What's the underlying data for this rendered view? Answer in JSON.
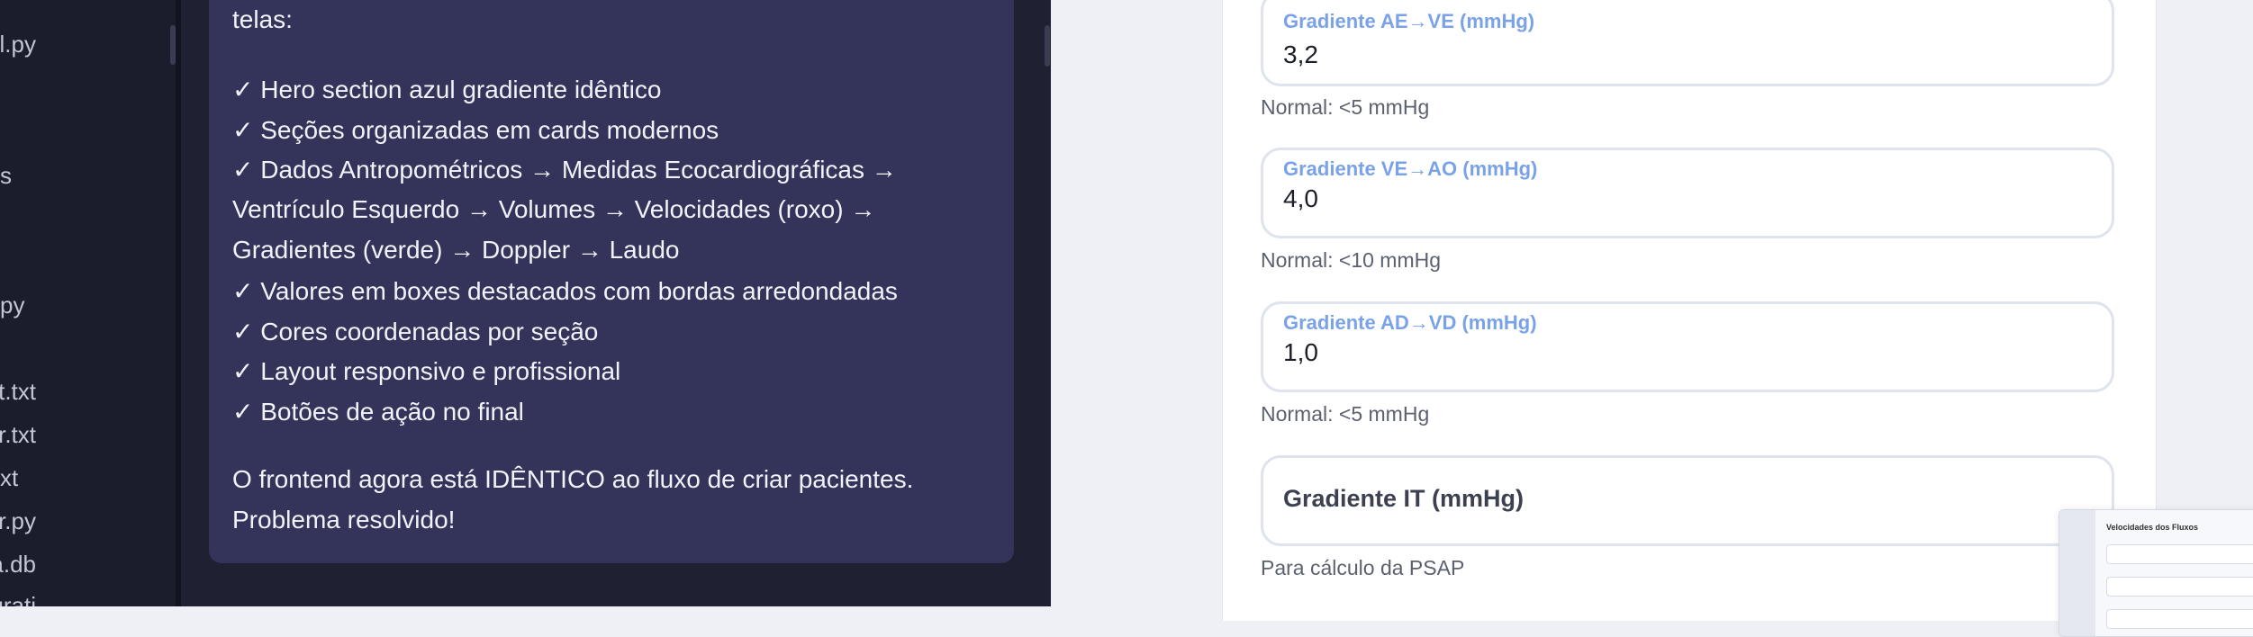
{
  "explorer": {
    "files": [
      "l.py",
      "s",
      "py",
      "est.txt",
      "user.txt",
      "xt",
      "st_user.py",
      "grama.db",
      "user_migrati"
    ]
  },
  "chat": {
    "lines": [
      "telas:",
      "✓ Hero section azul gradiente idêntico",
      "✓ Seções organizadas em cards modernos",
      "✓ Dados Antropométricos → Medidas Ecocardiográficas →",
      "Ventrículo Esquerdo → Volumes → Velocidades (roxo) →",
      "Gradientes (verde) → Doppler → Laudo",
      "✓ Valores em boxes destacados com bordas arredondadas",
      "✓ Cores coordenadas por seção",
      "✓ Layout responsivo e profissional",
      "✓ Botões de ação no final",
      "O frontend agora está IDÊNTICO ao fluxo de criar pacientes.",
      "Problema resolvido!"
    ]
  },
  "form": {
    "fields": [
      {
        "label": "Gradiente AE→VE (mmHg)",
        "value": "3,2",
        "hint": "Normal: <5 mmHg"
      },
      {
        "label": "Gradiente VE→AO (mmHg)",
        "value": "4,0",
        "hint": "Normal: <10 mmHg"
      },
      {
        "label": "Gradiente AD→VD (mmHg)",
        "value": "1,0",
        "hint": "Normal: <5 mmHg"
      }
    ],
    "it_field": {
      "title": "Gradiente IT (mmHg)",
      "hint": "Para cálculo da PSAP"
    }
  },
  "thumbnail": {
    "title": "Velocidades dos Fluxos"
  }
}
